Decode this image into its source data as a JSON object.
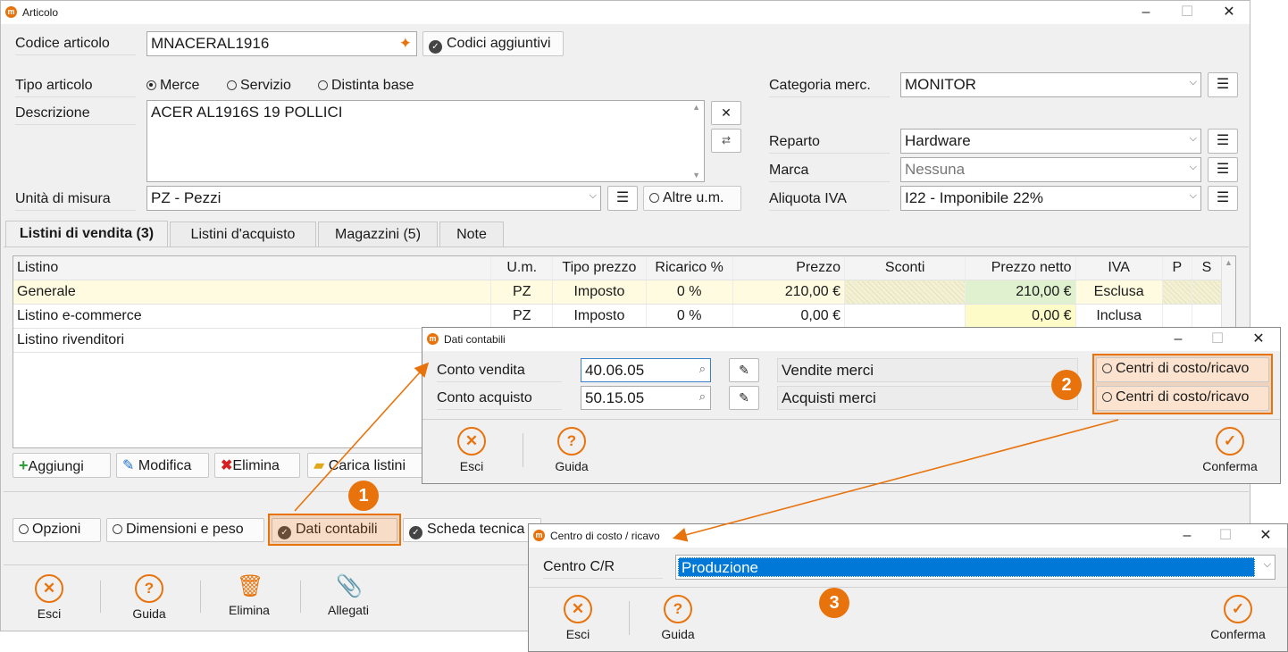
{
  "main": {
    "title": "Articolo",
    "codice_label": "Codice articolo",
    "codice_value": "MNACERAL1916",
    "codici_aggiuntivi": "Codici aggiuntivi",
    "tipo_label": "Tipo articolo",
    "tipo_options": [
      "Merce",
      "Servizio",
      "Distinta base"
    ],
    "tipo_selected": "Merce",
    "descrizione_label": "Descrizione",
    "descrizione_value": "ACER AL1916S 19 POLLICI",
    "um_label": "Unità di misura",
    "um_value": "PZ - Pezzi",
    "altre_um": "Altre u.m.",
    "categoria_label": "Categoria merc.",
    "categoria_value": "MONITOR",
    "reparto_label": "Reparto",
    "reparto_value": "Hardware",
    "marca_label": "Marca",
    "marca_value": "Nessuna",
    "iva_label": "Aliquota IVA",
    "iva_value": "I22 - Imponibile 22%",
    "tabs": [
      "Listini di vendita (3)",
      "Listini d'acquisto",
      "Magazzini (5)",
      "Note"
    ],
    "grid_headers": [
      "Listino",
      "U.m.",
      "Tipo prezzo",
      "Ricarico %",
      "Prezzo",
      "Sconti",
      "Prezzo netto",
      "IVA",
      "P",
      "S"
    ],
    "grid_rows": [
      [
        "Generale",
        "PZ",
        "Imposto",
        "0 %",
        "210,00 €",
        "",
        "210,00 €",
        "Esclusa"
      ],
      [
        "Listino e-commerce",
        "PZ",
        "Imposto",
        "0 %",
        "0,00 €",
        "",
        "0,00 €",
        "Inclusa"
      ],
      [
        "Listino rivenditori",
        "",
        "",
        "",
        "",
        "",
        "",
        ""
      ]
    ],
    "grid_buttons": [
      "Aggiungi",
      "Modifica",
      "Elimina",
      "Carica listini"
    ],
    "bottom_tabs": [
      "Opzioni",
      "Dimensioni e peso",
      "Dati contabili",
      "Scheda tecnica"
    ],
    "footer": [
      "Esci",
      "Guida",
      "Elimina",
      "Allegati"
    ]
  },
  "dati": {
    "title": "Dati contabili",
    "vendita_label": "Conto vendita",
    "vendita_value": "40.06.05",
    "vendita_desc": "Vendite merci",
    "acquisto_label": "Conto acquisto",
    "acquisto_value": "50.15.05",
    "acquisto_desc": "Acquisti merci",
    "centri": "Centri di costo/ricavo",
    "footer": [
      "Esci",
      "Guida",
      "Conferma"
    ]
  },
  "centro": {
    "title": "Centro di costo / ricavo",
    "label": "Centro C/R",
    "value": "Produzione",
    "footer": [
      "Esci",
      "Guida",
      "Conferma"
    ]
  },
  "badges": [
    "1",
    "2",
    "3"
  ],
  "colors": {
    "accent": "#e8730c",
    "selection": "#0078d7"
  }
}
